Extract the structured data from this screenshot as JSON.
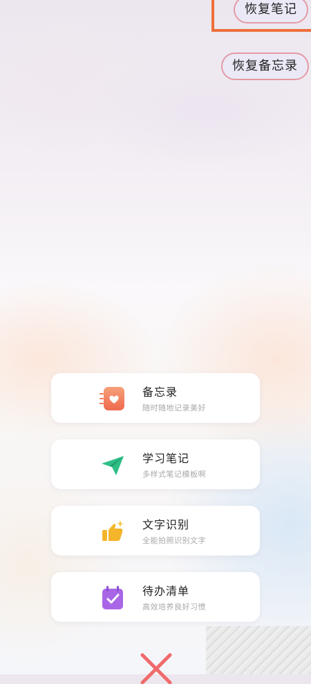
{
  "top_buttons": {
    "restore_notes": "恢复笔记",
    "restore_memo": "恢复备忘录"
  },
  "menu_items": [
    {
      "title": "备忘录",
      "subtitle": "随时随地记录美好",
      "icon": "memo-heart-icon",
      "color": "#f07a5a"
    },
    {
      "title": "学习笔记",
      "subtitle": "多样式笔记模板啊",
      "icon": "paper-plane-icon",
      "color": "#2fbf86"
    },
    {
      "title": "文字识别",
      "subtitle": "全能拍照识别文字",
      "icon": "thumbs-up-icon",
      "color": "#f5b52a"
    },
    {
      "title": "待办清单",
      "subtitle": "高效培养良好习惯",
      "icon": "calendar-check-icon",
      "color": "#a866e6"
    }
  ],
  "colors": {
    "highlight": "#ee6f3a",
    "pill_border": "#e39aa4",
    "close": "#f06a6a"
  }
}
